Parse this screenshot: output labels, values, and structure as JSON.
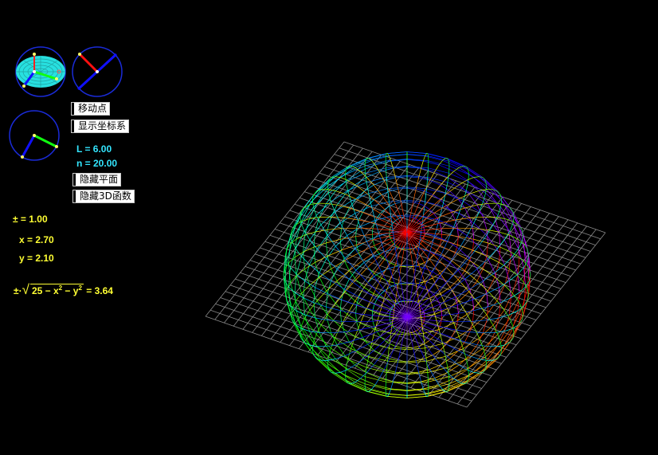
{
  "controls": {
    "move_point": "移动点",
    "show_axes": "显示坐标系",
    "hide_plane": "隐藏平面",
    "hide_3d_function": "隐藏3D函数"
  },
  "params": {
    "L": "L = 6.00",
    "n": "n = 20.00"
  },
  "values": {
    "pm": "± = 1.00",
    "x": "x = 2.70",
    "y": "y = 2.10"
  },
  "formula": {
    "prefix": "±·",
    "radicand_a": "25 − x",
    "exp1": "2",
    "radicand_b": " − y",
    "exp2": "2",
    "result": " = 3.64"
  },
  "colors": {
    "background": "#000000",
    "param_text": "#33e6ff",
    "value_text": "#ffff33"
  }
}
